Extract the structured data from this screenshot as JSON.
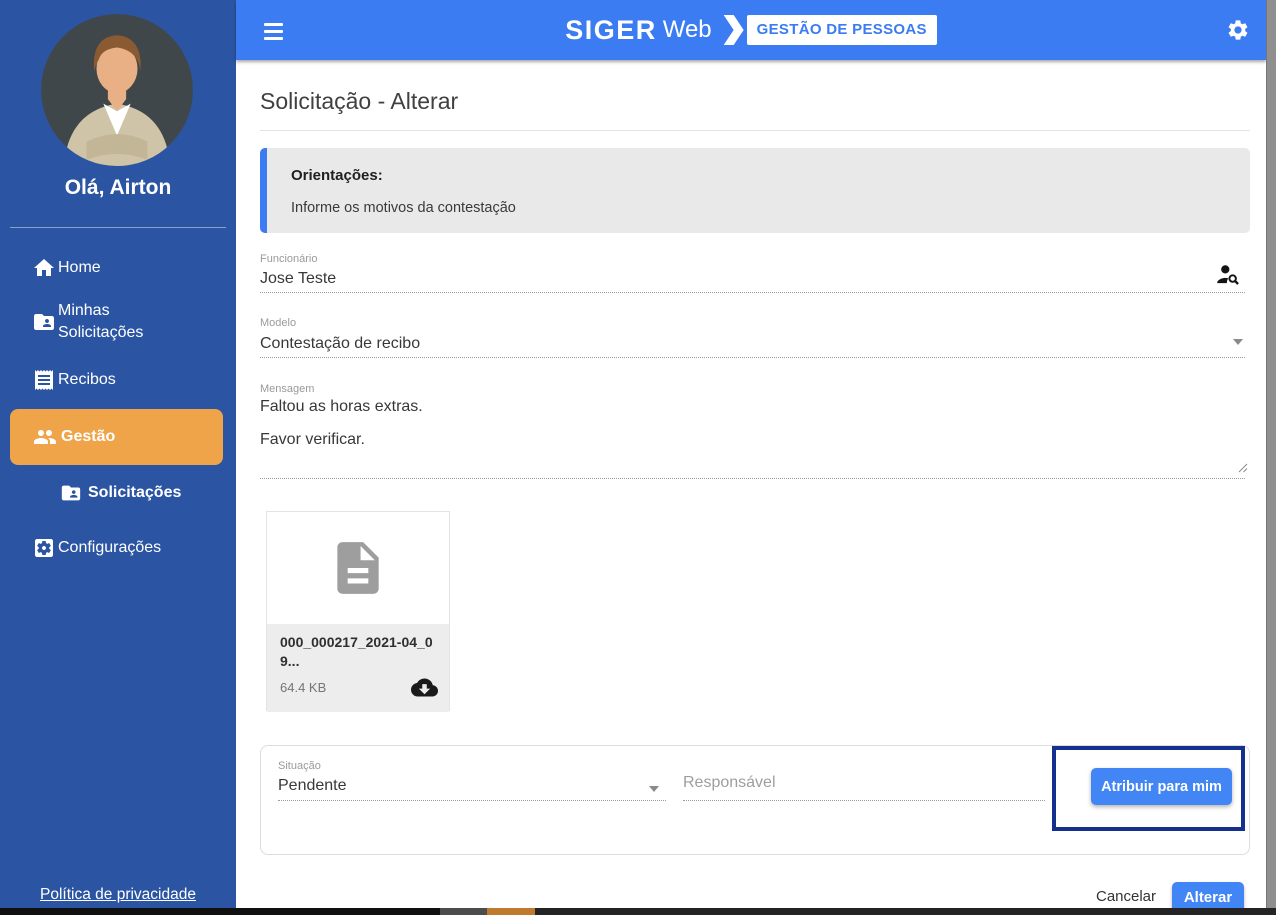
{
  "header": {
    "brand_primary": "SIGER",
    "brand_secondary": "Web",
    "badge_label": "GESTÃO DE PESSOAS",
    "icons": {
      "menu": "hamburger-icon",
      "settings": "gear-icon"
    }
  },
  "sidebar": {
    "greeting": "Olá, Airton",
    "items": [
      {
        "label": "Home",
        "icon": "home-icon",
        "active": false
      },
      {
        "label": "Minhas Solicitações",
        "icon": "folder-shared-icon",
        "active": false
      },
      {
        "label": "Recibos",
        "icon": "receipt-icon",
        "active": false
      },
      {
        "label": "Gestão",
        "icon": "people-icon",
        "active": true
      },
      {
        "label": "Solicitações",
        "icon": "folder-shared-icon",
        "active": false,
        "sub_item": true
      },
      {
        "label": "Configurações",
        "icon": "settings-box-icon",
        "active": false
      }
    ],
    "privacy_link": "Política de privacidade"
  },
  "main": {
    "title": "Solicitação - Alterar",
    "guidance": {
      "title": "Orientações:",
      "text": "Informe os motivos da contestação"
    },
    "fields": {
      "funcionario": {
        "label": "Funcionário",
        "value": "Jose Teste",
        "icon": "person-search-icon"
      },
      "modelo": {
        "label": "Modelo",
        "value": "Contestação de recibo",
        "icon": "caret-down-icon"
      },
      "mensagem": {
        "label": "Mensagem",
        "value": "Faltou as horas extras.\n\nFavor verificar."
      },
      "situacao": {
        "label": "Situação",
        "value": "Pendente",
        "icon": "caret-down-icon"
      },
      "responsavel": {
        "placeholder": "Responsável"
      }
    },
    "attachment": {
      "filename": "000_000217_2021-04_09...",
      "filesize": "64.4 KB",
      "icons": {
        "preview": "document-icon",
        "download": "cloud-download-icon"
      }
    },
    "actions": {
      "assign_button": "Atribuir para mim",
      "cancel_button": "Cancelar",
      "submit_button": "Alterar"
    }
  },
  "colors": {
    "header_blue": "#3b7cf2",
    "sidebar_blue": "#2b55a3",
    "active_orange": "#f0a44a",
    "button_blue": "#4285f4",
    "highlight_border_navy": "#15318f",
    "guidance_bg": "#e9e9e9"
  }
}
